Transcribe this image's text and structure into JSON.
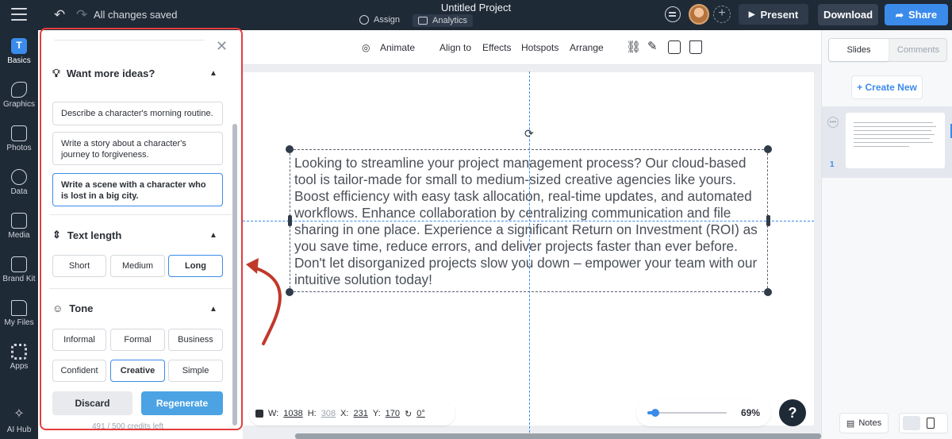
{
  "topbar": {
    "saved_status": "All changes saved",
    "project_title": "Untitled Project",
    "assign_label": "Assign",
    "analytics_label": "Analytics",
    "present_label": "Present",
    "download_label": "Download",
    "share_label": "Share"
  },
  "rail": {
    "items": [
      {
        "label": "Basics",
        "icon": "T"
      },
      {
        "label": "Graphics"
      },
      {
        "label": "Photos"
      },
      {
        "label": "Data"
      },
      {
        "label": "Media"
      },
      {
        "label": "Brand Kit"
      },
      {
        "label": "My Files"
      },
      {
        "label": "Apps"
      },
      {
        "label": "AI Hub"
      }
    ]
  },
  "ai_panel": {
    "ideas_title": "Want more ideas?",
    "ideas": [
      "Describe a character's morning routine.",
      "Write a story about a character's journey to forgiveness.",
      "Write a scene with a character who is lost in a big city."
    ],
    "length_title": "Text length",
    "length_options": [
      "Short",
      "Medium",
      "Long"
    ],
    "length_selected": "Long",
    "tone_title": "Tone",
    "tone_options": [
      "Informal",
      "Formal",
      "Business",
      "Confident",
      "Creative",
      "Simple"
    ],
    "tone_selected": "Creative",
    "discard_label": "Discard",
    "regenerate_label": "Regenerate",
    "credits": "491 / 500 credits left"
  },
  "toolbar": {
    "animate": "Animate",
    "align": "Align to",
    "effects": "Effects",
    "hotspots": "Hotspots",
    "arrange": "Arrange"
  },
  "slide": {
    "body_text": "Looking to streamline your project management process? Our cloud-based tool is tailor-made for small to medium-sized creative agencies like yours. Boost efficiency with easy task allocation, real-time updates, and automated workflows. Enhance collaboration by centralizing communication and file sharing in one place. Experience a significant Return on Investment (ROI) as you save time, reduce errors, and deliver projects faster than ever before. Don't let disorganized projects slow you down – empower your team with our intuitive solution today!"
  },
  "dimensions": {
    "w_label": "W:",
    "w": "1038",
    "h_label": "H:",
    "h": "308",
    "x_label": "X:",
    "x": "231",
    "y_label": "Y:",
    "y": "170",
    "rotation": "0°"
  },
  "zoom": {
    "level": "69%",
    "fraction": 0.1
  },
  "help_label": "?",
  "right_panel": {
    "tab_slides": "Slides",
    "tab_comments": "Comments",
    "create_new": "+ Create New",
    "slide_number": "1",
    "notes_label": "Notes"
  },
  "colors": {
    "accent": "#3b8bea",
    "topbar": "#1f2a37",
    "highlight_border": "#e33d3d",
    "arrow": "#c0392b"
  }
}
